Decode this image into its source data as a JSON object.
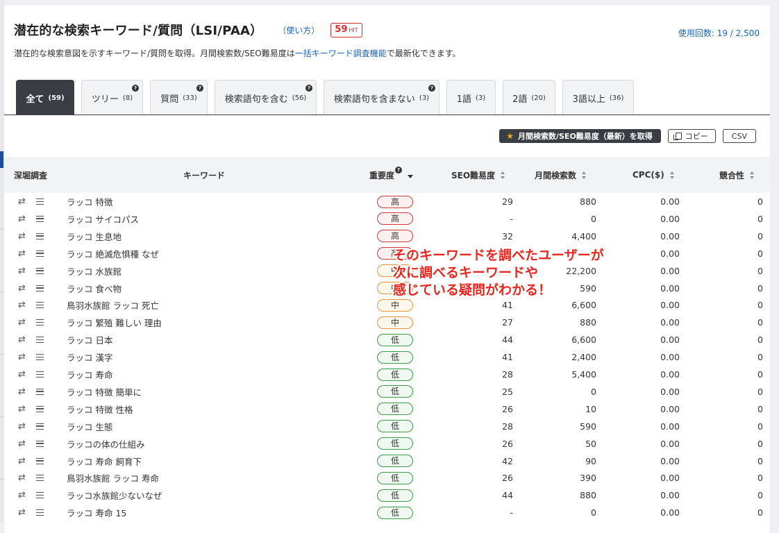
{
  "header": {
    "title": "潜在的な検索キーワード/質問（LSI/PAA）",
    "howto": "（使い方）",
    "hit_count": "59",
    "hit_suffix": "HIT",
    "usage": "使用回数: 19 / 2,500"
  },
  "description": {
    "before": "潜在的な検索意図を示すキーワード/質問を取得。月間検索数/SEO難易度は",
    "link": "一括キーワード調査機能",
    "after": "で最新化できます。"
  },
  "tabs": [
    {
      "label": "全て",
      "count": "(59)",
      "active": true
    },
    {
      "label": "ツリー",
      "count": "(8)"
    },
    {
      "label": "質問",
      "count": "(33)"
    },
    {
      "label": "検索語句を含む",
      "count": "(56)"
    },
    {
      "label": "検索語句を含まない",
      "count": "(3)"
    },
    {
      "label": "1語",
      "count": "(3)"
    },
    {
      "label": "2語",
      "count": "(20)"
    },
    {
      "label": "3語以上",
      "count": "(36)"
    }
  ],
  "actions": {
    "fetch_label": "月間検索数/SEO難易度（最新）を取得",
    "copy_label": "コピー",
    "csv_label": "CSV"
  },
  "table": {
    "headers": {
      "deep": "深堀調査",
      "keyword": "キーワード",
      "importance": "重要度",
      "seo": "SEO難易度",
      "volume": "月間検索数",
      "cpc": "CPC($)",
      "competition": "競合性"
    },
    "rows": [
      {
        "keyword": "ラッコ 特徴",
        "importance": "高",
        "level": "high",
        "seo": "29",
        "volume": "880",
        "cpc": "0.00",
        "competition": "0"
      },
      {
        "keyword": "ラッコ サイコパス",
        "importance": "高",
        "level": "high",
        "seo": "-",
        "volume": "0",
        "cpc": "0.00",
        "competition": "0"
      },
      {
        "keyword": "ラッコ 生息地",
        "importance": "高",
        "level": "high",
        "seo": "32",
        "volume": "4,400",
        "cpc": "0.00",
        "competition": "0"
      },
      {
        "keyword": "ラッコ 絶滅危惧種 なぜ",
        "importance": "高",
        "level": "high",
        "seo": "",
        "volume": "",
        "cpc": "0.00",
        "competition": "0"
      },
      {
        "keyword": "ラッコ 水族館",
        "importance": "中",
        "level": "mid",
        "seo": "",
        "volume": "22,200",
        "cpc": "0.00",
        "competition": "0"
      },
      {
        "keyword": "ラッコ 食べ物",
        "importance": "中",
        "level": "mid",
        "seo": "",
        "volume": "590",
        "cpc": "0.00",
        "competition": "0"
      },
      {
        "keyword": "鳥羽水族館 ラッコ 死亡",
        "importance": "中",
        "level": "mid",
        "seo": "41",
        "volume": "6,600",
        "cpc": "0.00",
        "competition": "0"
      },
      {
        "keyword": "ラッコ 繁殖 難しい 理由",
        "importance": "中",
        "level": "mid",
        "seo": "27",
        "volume": "880",
        "cpc": "0.00",
        "competition": "0"
      },
      {
        "keyword": "ラッコ 日本",
        "importance": "低",
        "level": "low",
        "seo": "44",
        "volume": "6,600",
        "cpc": "0.00",
        "competition": "0"
      },
      {
        "keyword": "ラッコ 漢字",
        "importance": "低",
        "level": "low",
        "seo": "41",
        "volume": "2,400",
        "cpc": "0.00",
        "competition": "0"
      },
      {
        "keyword": "ラッコ 寿命",
        "importance": "低",
        "level": "low",
        "seo": "28",
        "volume": "5,400",
        "cpc": "0.00",
        "competition": "0"
      },
      {
        "keyword": "ラッコ 特徴 簡単に",
        "importance": "低",
        "level": "low",
        "seo": "25",
        "volume": "0",
        "cpc": "0.00",
        "competition": "0"
      },
      {
        "keyword": "ラッコ 特徴 性格",
        "importance": "低",
        "level": "low",
        "seo": "26",
        "volume": "10",
        "cpc": "0.00",
        "competition": "0"
      },
      {
        "keyword": "ラッコ 生態",
        "importance": "低",
        "level": "low",
        "seo": "28",
        "volume": "590",
        "cpc": "0.00",
        "competition": "0"
      },
      {
        "keyword": "ラッコの体の仕組み",
        "importance": "低",
        "level": "low",
        "seo": "26",
        "volume": "50",
        "cpc": "0.00",
        "competition": "0"
      },
      {
        "keyword": "ラッコ 寿命 飼育下",
        "importance": "低",
        "level": "low",
        "seo": "42",
        "volume": "90",
        "cpc": "0.00",
        "competition": "0"
      },
      {
        "keyword": "鳥羽水族館 ラッコ 寿命",
        "importance": "低",
        "level": "low",
        "seo": "26",
        "volume": "390",
        "cpc": "0.00",
        "competition": "0"
      },
      {
        "keyword": "ラッコ水族館少ないなぜ",
        "importance": "低",
        "level": "low",
        "seo": "44",
        "volume": "880",
        "cpc": "0.00",
        "competition": "0"
      },
      {
        "keyword": "ラッコ 寿命 15",
        "importance": "低",
        "level": "low",
        "seo": "-",
        "volume": "0",
        "cpc": "0.00",
        "competition": "0"
      }
    ]
  },
  "annotation": {
    "line1": "そのキーワードを調べたユーザーが",
    "line2": "次に調べるキーワードや",
    "line3": "感じている疑問がわかる！"
  },
  "colors": {
    "accent": "#1a64b8",
    "dark": "#3a3d44",
    "high": "#d43a3a",
    "mid": "#e8933a",
    "low": "#3a9a4a",
    "annotation": "#e8261d"
  }
}
